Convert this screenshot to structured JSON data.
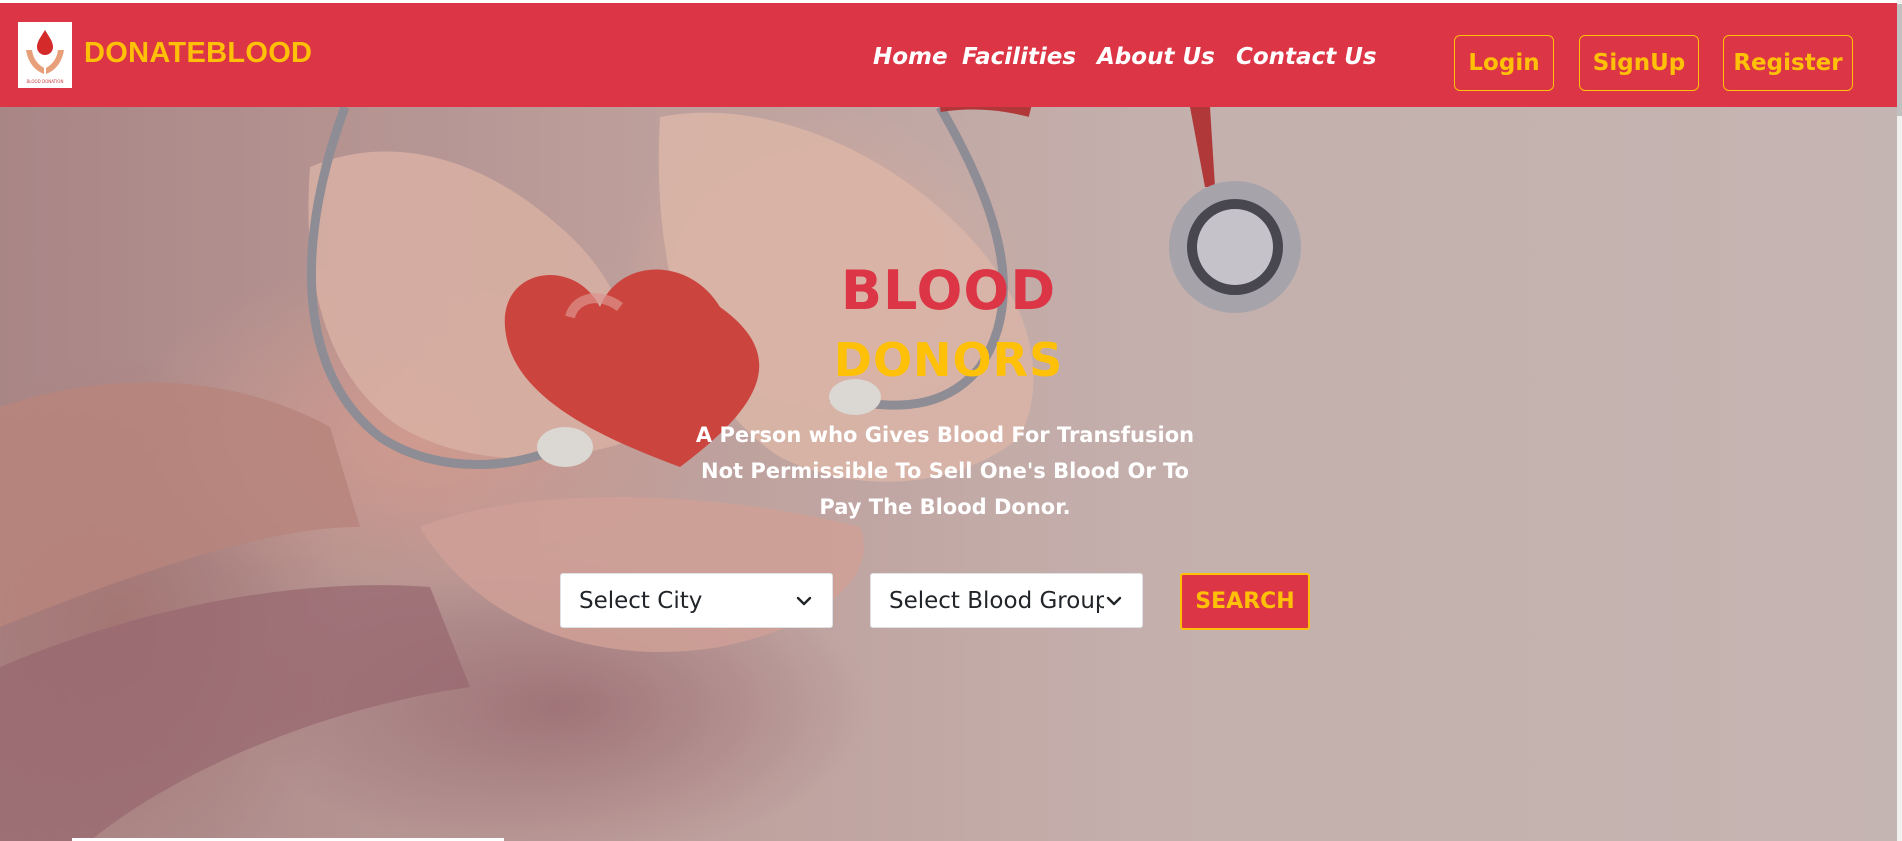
{
  "brand": {
    "name": "DONATEBLOOD",
    "logo_icon": "hands-blood-drop-icon",
    "logo_caption": "BLOOD DONATION"
  },
  "nav": {
    "links": [
      "Home",
      "Facilities",
      "About Us",
      "Contact Us"
    ],
    "buttons": [
      "Login",
      "SignUp",
      "Register"
    ]
  },
  "hero": {
    "title_line1": "BLOOD",
    "title_line2": "DONORS",
    "description_lines": [
      "A Person who Gives Blood For Transfusion",
      "Not Permissible To Sell One's Blood Or To",
      "Pay The Blood Donor."
    ],
    "background_image": "hands-holding-heart-stethoscope"
  },
  "search": {
    "city_select": "Select City",
    "blood_group_select": "Select Blood Group",
    "button_label": "SEARCH"
  },
  "colors": {
    "primary": "#dc3545",
    "accent": "#ffc107",
    "text_light": "#ffffff"
  }
}
